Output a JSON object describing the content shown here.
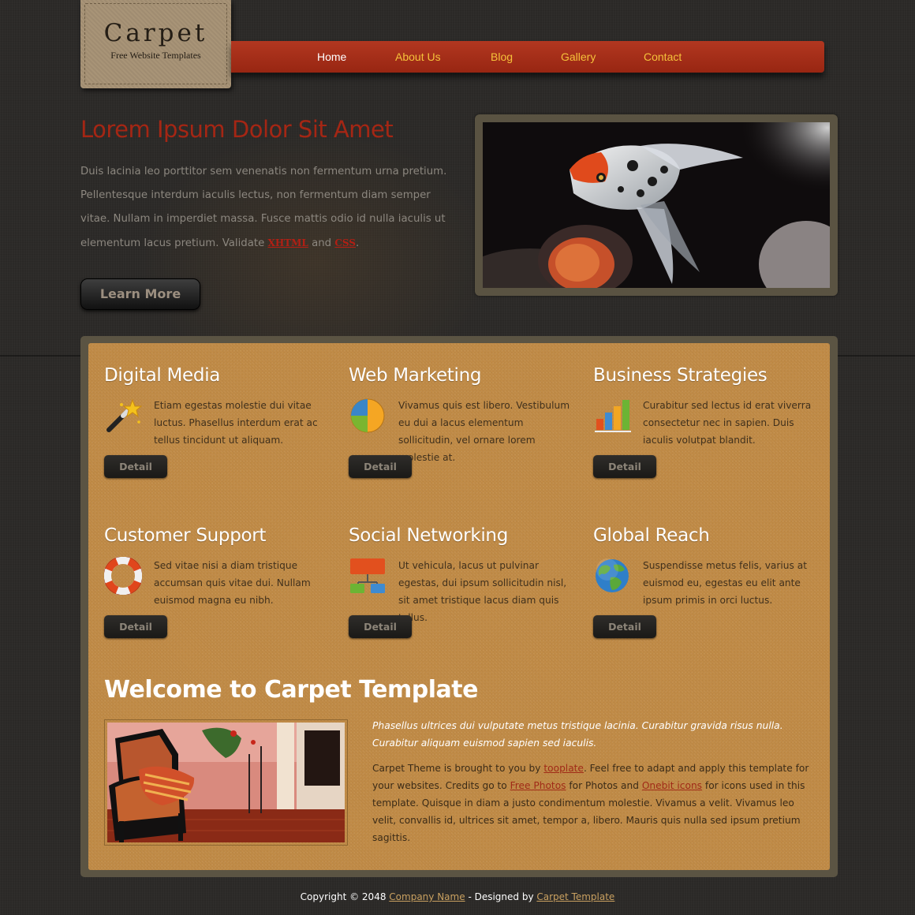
{
  "logo": {
    "title": "Carpet",
    "subtitle": "Free Website Templates"
  },
  "nav": {
    "items": [
      {
        "label": "Home",
        "active": true
      },
      {
        "label": "About Us"
      },
      {
        "label": "Blog"
      },
      {
        "label": "Gallery"
      },
      {
        "label": "Contact"
      }
    ]
  },
  "hero": {
    "title": "Lorem Ipsum Dolor Sit Amet",
    "text": "Duis lacinia leo porttitor sem venenatis non fermentum urna pretium. Pellentesque interdum iaculis lectus, non fermentum diam semper vitae. Nullam in imperdiet massa. Fusce mattis odio id nulla iaculis ut elementum lacus pretium. Validate",
    "xhtml_link": "XHTML",
    "and": "and",
    "css_link": "CSS",
    "period": ".",
    "button": "Learn More"
  },
  "services": [
    {
      "title": "Digital Media",
      "icon": "magic-wand-icon",
      "text": "Etiam egestas molestie dui vitae luctus. Phasellus interdum erat ac tellus tincidunt ut aliquam.",
      "button": "Detail"
    },
    {
      "title": "Web Marketing",
      "icon": "pie-chart-icon",
      "text": "Vivamus quis est libero. Vestibulum eu dui a lacus elementum sollicitudin, vel ornare lorem molestie at.",
      "button": "Detail"
    },
    {
      "title": "Business Strategies",
      "icon": "bar-chart-icon",
      "text": "Curabitur sed lectus id erat viverra consectetur nec in sapien. Duis iaculis volutpat blandit.",
      "button": "Detail"
    },
    {
      "title": "Customer Support",
      "icon": "lifebuoy-icon",
      "text": "Sed vitae nisi a diam tristique accumsan quis vitae dui. Nullam euismod magna eu nibh.",
      "button": "Detail"
    },
    {
      "title": "Social Networking",
      "icon": "network-icon",
      "text": "Ut vehicula, lacus ut pulvinar egestas, dui ipsum sollicitudin nisl, sit amet tristique lacus diam quis tellus.",
      "button": "Detail"
    },
    {
      "title": "Global Reach",
      "icon": "globe-icon",
      "text": "Suspendisse metus felis, varius at euismod eu, egestas eu elit ante ipsum primis in orci luctus.",
      "button": "Detail"
    }
  ],
  "welcome": {
    "title": "Welcome to Carpet Template",
    "intro": "Phasellus ultrices dui vulputate metus tristique lacinia. Curabitur gravida risus nulla. Curabitur aliquam euismod sapien sed iaculis.",
    "body_1": "Carpet Theme is brought to you by",
    "link_templatemo": "tooplate",
    "body_2": ". Feel free to adapt and apply this template for your websites. Credits go to",
    "link_photos": "Free Photos",
    "body_3": "for Photos and",
    "link_icons": "Onebit icons",
    "body_4": "for icons used in this template. Quisque in diam a justo condimentum molestie. Vivamus a velit. Vivamus leo velit, convallis id, ultrices sit amet, tempor a, libero. Mauris quis nulla sed ipsum pretium sagittis."
  },
  "footer": {
    "copyright": "Copyright © 2048",
    "company": "Company Name",
    "designed_by": "- Designed by",
    "designer": "Carpet Template"
  },
  "colors": {
    "background": "#2c2a28",
    "nav": "#a52d17",
    "nav_text": "#f5c13a",
    "hero_title": "#a52614",
    "panel": "#c08a45"
  }
}
